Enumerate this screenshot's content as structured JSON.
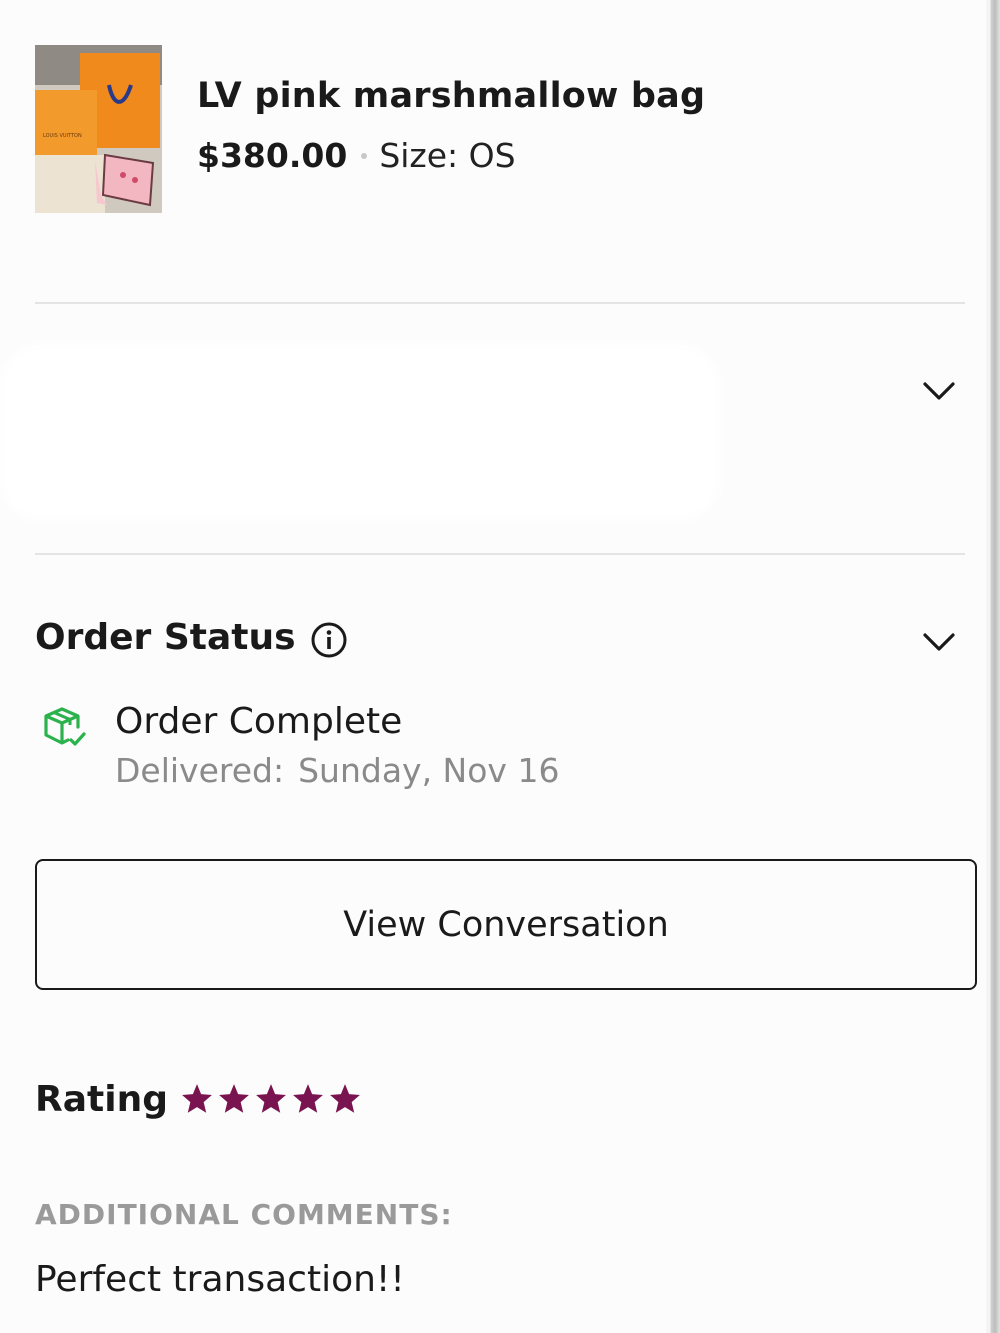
{
  "product": {
    "title": "LV pink marshmallow bag",
    "price": "$380.00",
    "size": "Size: OS",
    "thumbnail_brand_text": "LOUIS VUITTON"
  },
  "order_status": {
    "heading": "Order Status",
    "status_title": "Order Complete",
    "delivered_label": "Delivered:",
    "delivered_date": "Sunday, Nov 16"
  },
  "actions": {
    "view_conversation": "View Conversation"
  },
  "rating": {
    "heading": "Rating",
    "stars": 5,
    "max_stars": 5
  },
  "comments": {
    "label": "ADDITIONAL COMMENTS:",
    "text": "Perfect transaction!!"
  },
  "icons": {
    "info": "info-icon",
    "status": "package-check-icon",
    "chevron": "chevron-down-icon",
    "star": "star-icon"
  },
  "colors": {
    "star": "#7a1450",
    "status_icon": "#2bb24c",
    "muted_text": "#8a8a8a"
  }
}
